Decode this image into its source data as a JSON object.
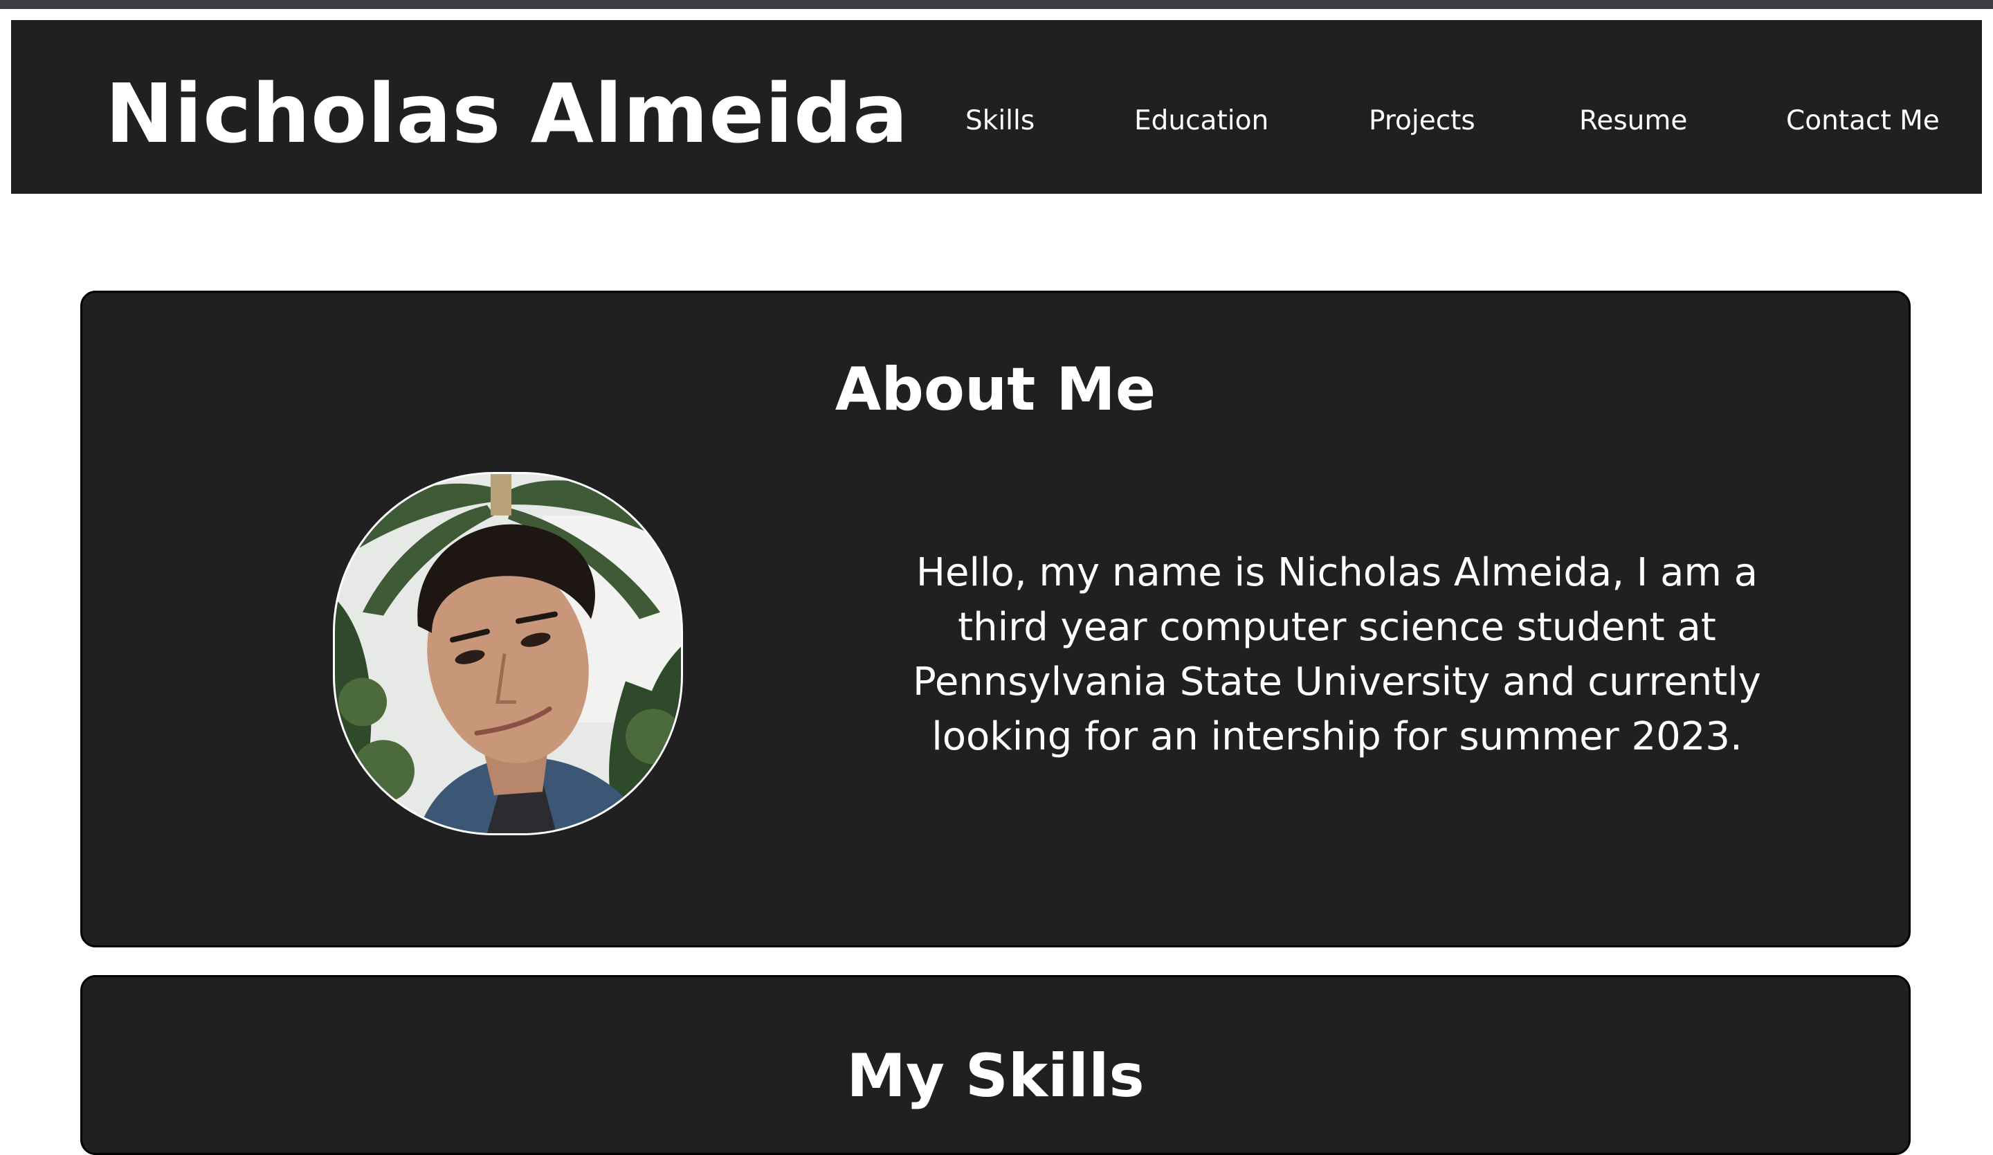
{
  "header": {
    "site_title": "Nicholas Almeida",
    "nav": [
      "Skills",
      "Education",
      "Projects",
      "Resume",
      "Contact Me"
    ]
  },
  "about": {
    "heading": "About Me",
    "bio": "Hello, my name is Nicholas Almeida, I am a third year computer science student at Pennsylvania State University and currently looking for an intership for summer 2023."
  },
  "skills": {
    "heading": "My Skills"
  },
  "colors": {
    "background": "#ffffff",
    "panel": "#202020",
    "text": "#ffffff",
    "top_strip": "#3e3c40"
  }
}
